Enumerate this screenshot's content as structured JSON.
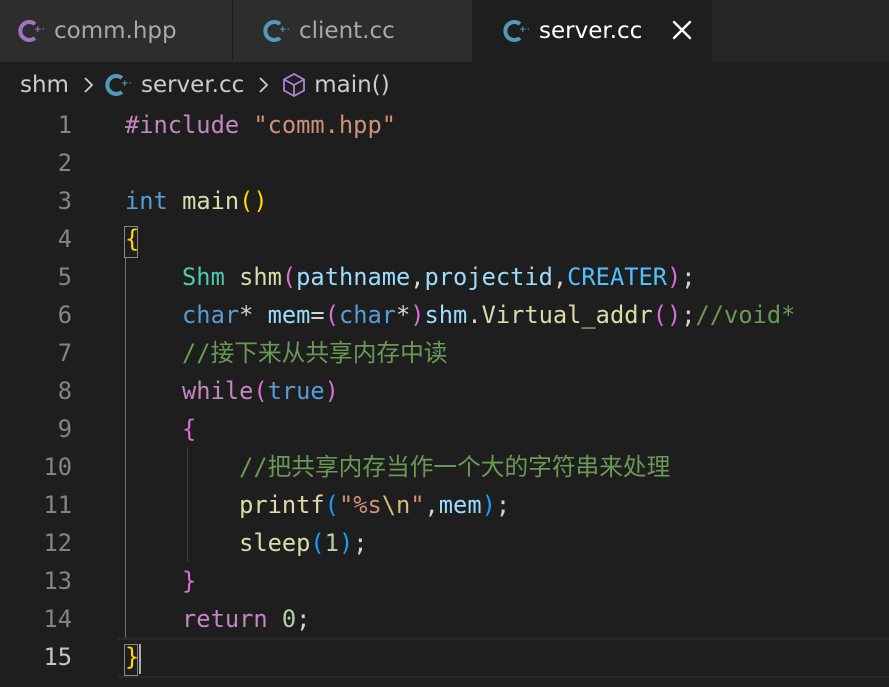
{
  "tabs": [
    {
      "label": "comm.hpp",
      "icon": "cpp-file-icon",
      "active": false
    },
    {
      "label": "client.cc",
      "icon": "cpp-file-icon",
      "active": false
    },
    {
      "label": "server.cc",
      "icon": "cpp-file-icon",
      "active": true
    }
  ],
  "breadcrumb": {
    "folder": "shm",
    "file": "server.cc",
    "symbol": "main()",
    "file_icon": "cpp-file-icon",
    "symbol_icon": "cube-method-icon"
  },
  "editor": {
    "active_line": 15,
    "lines": [
      {
        "n": "1",
        "tokens": [
          [
            "t-pre",
            "#include "
          ],
          [
            "t-str",
            "\"comm.hpp\""
          ]
        ]
      },
      {
        "n": "2",
        "tokens": []
      },
      {
        "n": "3",
        "tokens": [
          [
            "t-kw",
            "int"
          ],
          [
            "t-pun",
            " "
          ],
          [
            "t-fn",
            "main"
          ],
          [
            "t-b1",
            "()"
          ]
        ]
      },
      {
        "n": "4",
        "tokens": [
          [
            "t-b1",
            "{"
          ]
        ]
      },
      {
        "n": "5",
        "tokens": [
          [
            "t-pun",
            "    "
          ],
          [
            "t-type",
            "Shm"
          ],
          [
            "t-pun",
            " "
          ],
          [
            "t-fn",
            "shm"
          ],
          [
            "t-b2",
            "("
          ],
          [
            "t-var",
            "pathname"
          ],
          [
            "t-pun",
            ","
          ],
          [
            "t-var",
            "projectid"
          ],
          [
            "t-pun",
            ","
          ],
          [
            "t-const",
            "CREATER"
          ],
          [
            "t-b2",
            ")"
          ],
          [
            "t-pun",
            ";"
          ]
        ]
      },
      {
        "n": "6",
        "tokens": [
          [
            "t-pun",
            "    "
          ],
          [
            "t-kw",
            "char"
          ],
          [
            "t-pun",
            "* "
          ],
          [
            "t-var",
            "mem"
          ],
          [
            "t-pun",
            "="
          ],
          [
            "t-b2",
            "("
          ],
          [
            "t-kw",
            "char"
          ],
          [
            "t-pun",
            "*"
          ],
          [
            "t-b2",
            ")"
          ],
          [
            "t-var",
            "shm"
          ],
          [
            "t-pun",
            "."
          ],
          [
            "t-fn",
            "Virtual_addr"
          ],
          [
            "t-b2",
            "()"
          ],
          [
            "t-pun",
            ";"
          ],
          [
            "t-com",
            "//void*"
          ]
        ]
      },
      {
        "n": "7",
        "tokens": [
          [
            "t-pun",
            "    "
          ],
          [
            "t-com",
            "//接下来从共享内存中读"
          ]
        ]
      },
      {
        "n": "8",
        "tokens": [
          [
            "t-pun",
            "    "
          ],
          [
            "t-ctl",
            "while"
          ],
          [
            "t-b2",
            "("
          ],
          [
            "t-kw",
            "true"
          ],
          [
            "t-b2",
            ")"
          ]
        ]
      },
      {
        "n": "9",
        "tokens": [
          [
            "t-pun",
            "    "
          ],
          [
            "t-b2",
            "{"
          ]
        ]
      },
      {
        "n": "10",
        "tokens": [
          [
            "t-pun",
            "        "
          ],
          [
            "t-com",
            "//把共享内存当作一个大的字符串来处理"
          ]
        ]
      },
      {
        "n": "11",
        "tokens": [
          [
            "t-pun",
            "        "
          ],
          [
            "t-fn",
            "printf"
          ],
          [
            "t-b3",
            "("
          ],
          [
            "t-str",
            "\"%s"
          ],
          [
            "t-esc",
            "\\n"
          ],
          [
            "t-str",
            "\""
          ],
          [
            "t-pun",
            ","
          ],
          [
            "t-var",
            "mem"
          ],
          [
            "t-b3",
            ")"
          ],
          [
            "t-pun",
            ";"
          ]
        ]
      },
      {
        "n": "12",
        "tokens": [
          [
            "t-pun",
            "        "
          ],
          [
            "t-fn",
            "sleep"
          ],
          [
            "t-b3",
            "("
          ],
          [
            "t-num",
            "1"
          ],
          [
            "t-b3",
            ")"
          ],
          [
            "t-pun",
            ";"
          ]
        ]
      },
      {
        "n": "13",
        "tokens": [
          [
            "t-pun",
            "    "
          ],
          [
            "t-b2",
            "}"
          ]
        ]
      },
      {
        "n": "14",
        "tokens": [
          [
            "t-pun",
            "    "
          ],
          [
            "t-ctl",
            "return"
          ],
          [
            "t-pun",
            " "
          ],
          [
            "t-num",
            "0"
          ],
          [
            "t-pun",
            ";"
          ]
        ]
      },
      {
        "n": "15",
        "tokens": [
          [
            "t-b1",
            "}"
          ]
        ]
      }
    ]
  },
  "colors": {
    "background": "#1e1e1e",
    "tab_inactive": "#2d2d2d",
    "cpp_icon": "#a074c4",
    "cpp_icon_active": "#519aba"
  }
}
